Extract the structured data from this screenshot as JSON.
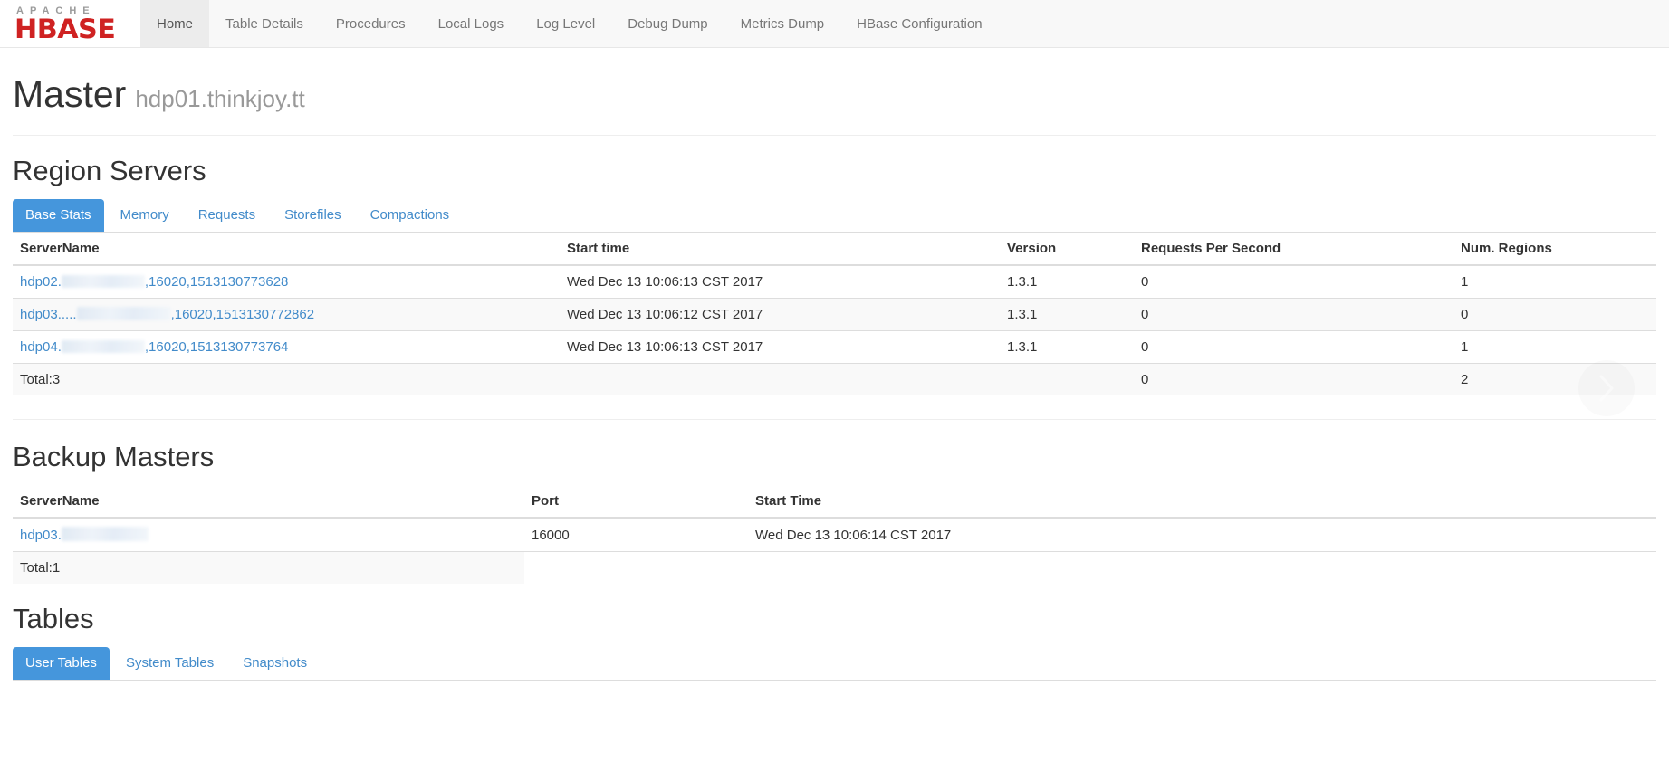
{
  "navbar": {
    "brand": {
      "line1": "APACHE",
      "line2": "HBASE"
    },
    "items": [
      {
        "label": "Home",
        "active": true
      },
      {
        "label": "Table Details",
        "active": false
      },
      {
        "label": "Procedures",
        "active": false
      },
      {
        "label": "Local Logs",
        "active": false
      },
      {
        "label": "Log Level",
        "active": false
      },
      {
        "label": "Debug Dump",
        "active": false
      },
      {
        "label": "Metrics Dump",
        "active": false
      },
      {
        "label": "HBase Configuration",
        "active": false
      }
    ]
  },
  "header": {
    "title": "Master",
    "subtitle": "hdp01.thinkjoy.tt"
  },
  "region_servers": {
    "title": "Region Servers",
    "tabs": [
      {
        "label": "Base Stats",
        "active": true
      },
      {
        "label": "Memory",
        "active": false
      },
      {
        "label": "Requests",
        "active": false
      },
      {
        "label": "Storefiles",
        "active": false
      },
      {
        "label": "Compactions",
        "active": false
      }
    ],
    "columns": [
      "ServerName",
      "Start time",
      "Version",
      "Requests Per Second",
      "Num. Regions"
    ],
    "rows": [
      {
        "server_prefix": "hdp02.",
        "server_suffix": ",16020,1513130773628",
        "start_time": "Wed Dec 13 10:06:13 CST 2017",
        "version": "1.3.1",
        "requests_per_second": "0",
        "num_regions": "1"
      },
      {
        "server_prefix": "hdp03.....",
        "server_suffix": ",16020,1513130772862",
        "start_time": "Wed Dec 13 10:06:12 CST 2017",
        "version": "1.3.1",
        "requests_per_second": "0",
        "num_regions": "0"
      },
      {
        "server_prefix": "hdp04.",
        "server_suffix": ",16020,1513130773764",
        "start_time": "Wed Dec 13 10:06:13 CST 2017",
        "version": "1.3.1",
        "requests_per_second": "0",
        "num_regions": "1"
      }
    ],
    "total": {
      "label": "Total:3",
      "start_time": "",
      "version": "",
      "requests_per_second": "0",
      "num_regions": "2"
    }
  },
  "backup_masters": {
    "title": "Backup Masters",
    "columns": [
      "ServerName",
      "Port",
      "Start Time"
    ],
    "rows": [
      {
        "server_prefix": "hdp03.",
        "server_suffix": "",
        "port": "16000",
        "start_time": "Wed Dec 13 10:06:14 CST 2017"
      }
    ],
    "total": {
      "label": "Total:1",
      "port": "",
      "start_time": ""
    }
  },
  "tables_section": {
    "title": "Tables",
    "tabs": [
      {
        "label": "User Tables",
        "active": true
      },
      {
        "label": "System Tables",
        "active": false
      },
      {
        "label": "Snapshots",
        "active": false
      }
    ]
  },
  "overlay": {
    "next_arrow": "chevron-right"
  },
  "colors": {
    "brand_red": "#cf2222",
    "link_blue": "#428bca",
    "active_tab_blue": "#4596dc"
  }
}
